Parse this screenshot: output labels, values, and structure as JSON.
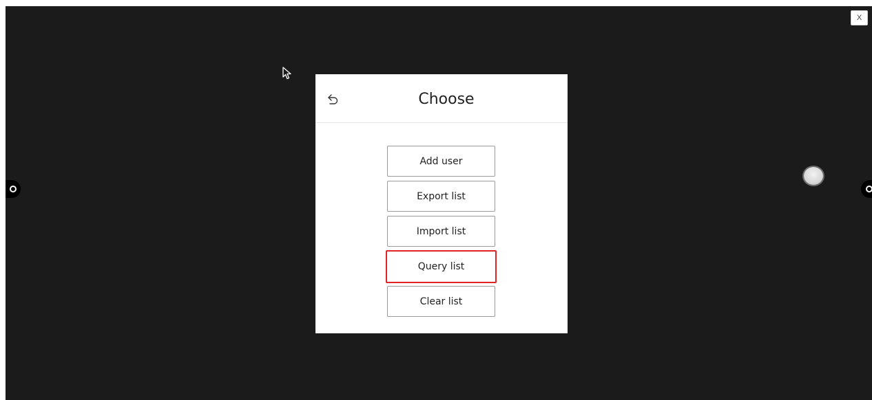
{
  "window": {
    "close_label": "X"
  },
  "dialog": {
    "title": "Choose",
    "back_icon": "back-arrow-icon",
    "buttons": [
      {
        "label": "Add user",
        "selected": false
      },
      {
        "label": "Export list",
        "selected": false
      },
      {
        "label": "Import list",
        "selected": false
      },
      {
        "label": "Query list",
        "selected": true
      },
      {
        "label": "Clear list",
        "selected": false
      }
    ]
  },
  "colors": {
    "background": "#1b1b1b",
    "dialog": "#ffffff",
    "selection_border": "#e02424",
    "button_border": "#9a9a9a"
  },
  "icons": {
    "cursor": "mouse-pointer-icon",
    "left_handle": "settings-handle-icon",
    "right_handle": "settings-handle-icon",
    "float_ball": "floating-ball-icon"
  }
}
